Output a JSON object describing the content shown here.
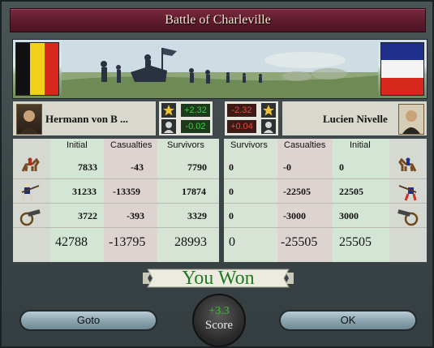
{
  "window": {
    "title": "Battle of Charleville"
  },
  "left_commander": {
    "name": "Hermann von B ...",
    "stats": [
      "+2.32",
      "-0.02"
    ],
    "icons": [
      "star-icon",
      "general-portrait-icon"
    ]
  },
  "right_commander": {
    "name": "Lucien Nivelle",
    "stats": [
      "-2.32",
      "+0.04"
    ],
    "icons": [
      "star-icon",
      "general-portrait-icon"
    ]
  },
  "left_table": {
    "headers": [
      "Initial",
      "Casualties",
      "Survivors"
    ],
    "rows": [
      {
        "unit": "cavalry-icon",
        "initial": "7833",
        "casualties": "-43",
        "survivors": "7790"
      },
      {
        "unit": "infantry-icon",
        "initial": "31233",
        "casualties": "-13359",
        "survivors": "17874"
      },
      {
        "unit": "artillery-icon",
        "initial": "3722",
        "casualties": "-393",
        "survivors": "3329"
      }
    ],
    "totals": {
      "initial": "42788",
      "casualties": "-13795",
      "survivors": "28993"
    }
  },
  "right_table": {
    "headers": [
      "Survivors",
      "Casualties",
      "Initial"
    ],
    "rows": [
      {
        "unit": "cavalry-icon",
        "survivors": "0",
        "casualties": "-0",
        "initial": "0"
      },
      {
        "unit": "infantry-icon",
        "survivors": "0",
        "casualties": "-22505",
        "initial": "22505"
      },
      {
        "unit": "artillery-icon",
        "survivors": "0",
        "casualties": "-3000",
        "initial": "3000"
      }
    ],
    "totals": {
      "survivors": "0",
      "casualties": "-25505",
      "initial": "25505"
    }
  },
  "result": {
    "text": "You Won"
  },
  "score": {
    "value": "+3.3",
    "label": "Score"
  },
  "buttons": {
    "goto": "Goto",
    "ok": "OK"
  },
  "colors": {
    "title_bar": "#6a2234",
    "positive": "#38d13a",
    "negative": "#e8483a",
    "result_text": "#1f7a22",
    "survivors_col": "#d7e3d4",
    "casualties_col": "#ddd3d0",
    "initial_col": "#d3e6d6"
  }
}
